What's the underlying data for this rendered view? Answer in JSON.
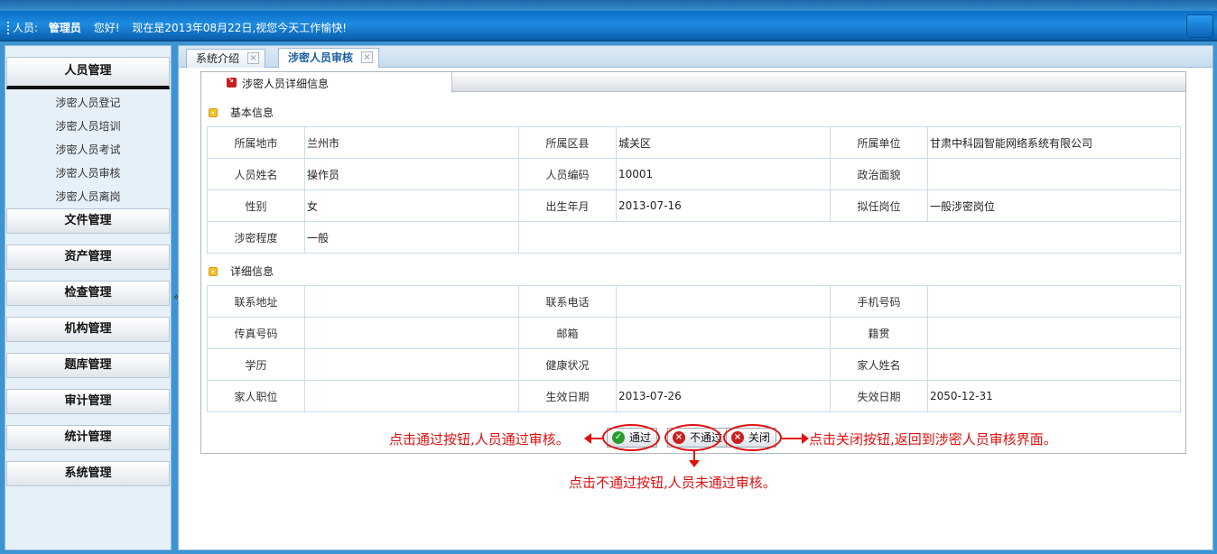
{
  "header": {
    "user_label": "人员:",
    "user_name": "管理员",
    "greeting": "您好!",
    "message": "现在是2013年08月22日,视您今天工作愉快!"
  },
  "sidebar": {
    "active_group": "人员管理",
    "sub_items": [
      "涉密人员登记",
      "涉密人员培训",
      "涉密人员考试",
      "涉密人员审核",
      "涉密人员离岗"
    ],
    "groups": [
      "文件管理",
      "资产管理",
      "检查管理",
      "机构管理",
      "题库管理",
      "审计管理",
      "统计管理",
      "系统管理"
    ],
    "collapse_glyph": "«"
  },
  "tabs": [
    {
      "label": "系统介绍",
      "active": false
    },
    {
      "label": "涉密人员审核",
      "active": true
    }
  ],
  "panel": {
    "title": "涉密人员详细信息",
    "basic_title": "基本信息",
    "detail_title": "详细信息",
    "basic_rows": [
      [
        {
          "label": "所属地市",
          "value": "兰州市"
        },
        {
          "label": "所属区县",
          "value": "城关区"
        },
        {
          "label": "所属单位",
          "value": "甘肃中科园智能网络系统有限公司"
        }
      ],
      [
        {
          "label": "人员姓名",
          "value": "操作员"
        },
        {
          "label": "人员编码",
          "value": "10001"
        },
        {
          "label": "政治面貌",
          "value": ""
        }
      ],
      [
        {
          "label": "性别",
          "value": "女"
        },
        {
          "label": "出生年月",
          "value": "2013-07-16"
        },
        {
          "label": "拟任岗位",
          "value": "一般涉密岗位"
        }
      ],
      [
        {
          "label": "涉密程度",
          "value": "一般"
        }
      ]
    ],
    "detail_rows": [
      [
        {
          "label": "联系地址",
          "value": ""
        },
        {
          "label": "联系电话",
          "value": ""
        },
        {
          "label": "手机号码",
          "value": ""
        }
      ],
      [
        {
          "label": "传真号码",
          "value": ""
        },
        {
          "label": "邮箱",
          "value": ""
        },
        {
          "label": "籍贯",
          "value": ""
        }
      ],
      [
        {
          "label": "学历",
          "value": ""
        },
        {
          "label": "健康状况",
          "value": ""
        },
        {
          "label": "家人姓名",
          "value": ""
        }
      ],
      [
        {
          "label": "家人职位",
          "value": ""
        },
        {
          "label": "生效日期",
          "value": "2013-07-26"
        },
        {
          "label": "失效日期",
          "value": "2050-12-31"
        }
      ]
    ]
  },
  "buttons": {
    "pass": "通过",
    "reject": "不通过",
    "close": "关闭"
  },
  "annotations": {
    "pass": "点击通过按钮,人员通过审核。",
    "reject": "点击不通过按钮,人员未通过审核。",
    "close": "点击关闭按钮,返回到涉密人员审核界面。"
  },
  "colors": {
    "annotation": "#e01010",
    "header_blue": "#0a6fc7",
    "pass_icon": "#2a9a2a",
    "reject_icon": "#c82020"
  }
}
